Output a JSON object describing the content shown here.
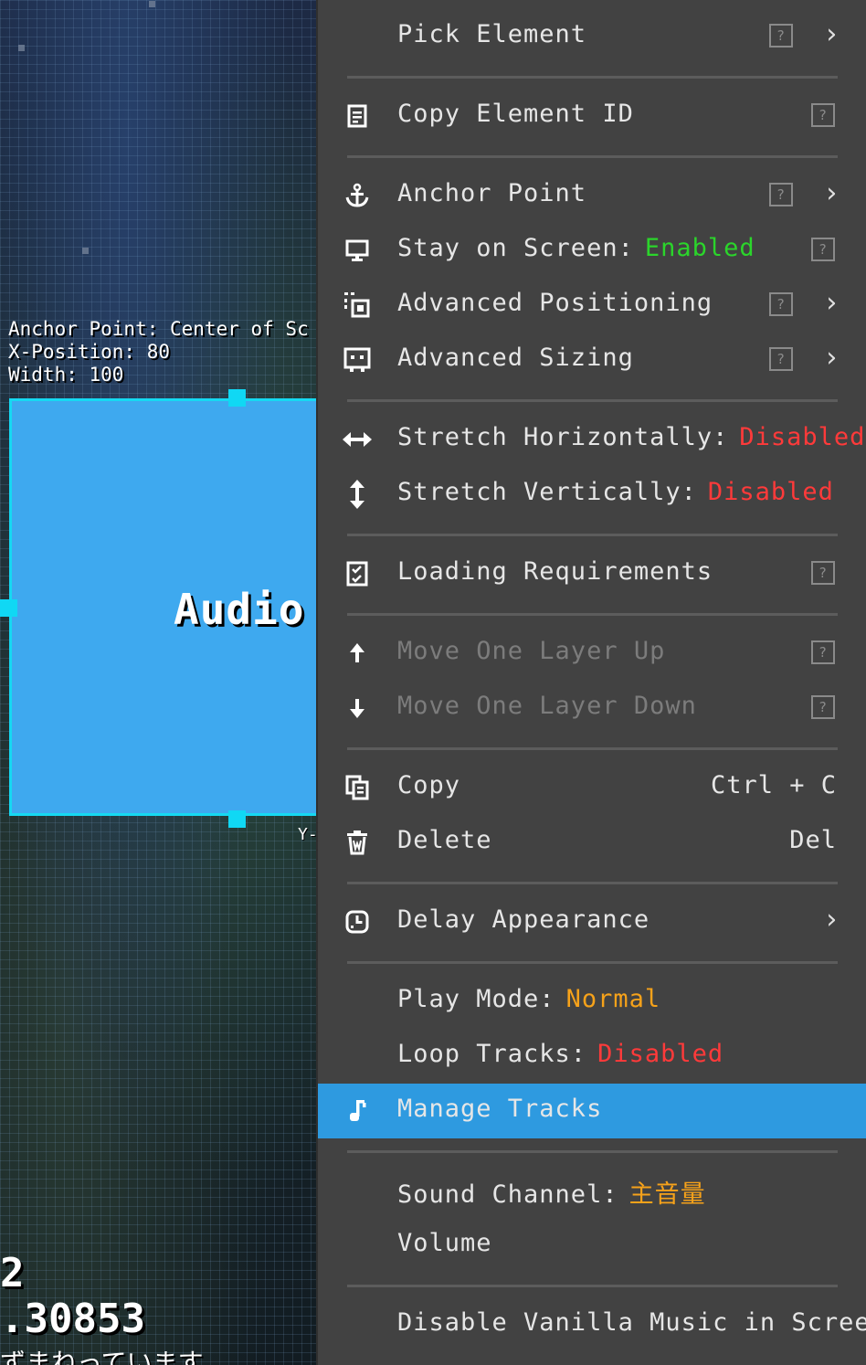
{
  "canvas": {
    "overlay_lines": [
      "Anchor Point: Center of Sc",
      "X-Position: 80",
      "Width: 100"
    ],
    "element_label": "Audio",
    "y_label": "Y-",
    "bottom_lines": [
      "2",
      ".30853"
    ],
    "bottom_jp": "ずまねっています"
  },
  "colors": {
    "menu_bg": "#424242",
    "highlight": "#2e9ae0",
    "enabled": "#2bd52b",
    "disabled": "#ff3a3a",
    "accent": "#f6a21a",
    "element_fill": "#3ea9ef",
    "element_border": "#16d9f2"
  },
  "menu": {
    "help_glyph": "?",
    "chevron": "›",
    "items": [
      {
        "label": "Pick Element",
        "icon": ""
      },
      {
        "label": "Copy Element ID",
        "icon": "document-icon"
      },
      {
        "label": "Anchor Point",
        "icon": "anchor-icon"
      },
      {
        "label": "Stay on Screen:",
        "value": "Enabled",
        "icon": "monitor-icon"
      },
      {
        "label": "Advanced Positioning",
        "icon": "positioning-icon"
      },
      {
        "label": "Advanced Sizing",
        "icon": "sizing-icon"
      },
      {
        "label": "Stretch Horizontally:",
        "value": "Disabled",
        "icon": "horizontal-arrows-icon"
      },
      {
        "label": "Stretch Vertically:",
        "value": "Disabled",
        "icon": "vertical-arrows-icon"
      },
      {
        "label": "Loading Requirements",
        "icon": "checklist-icon"
      },
      {
        "label": "Move One Layer Up",
        "icon": "arrow-up-icon"
      },
      {
        "label": "Move One Layer Down",
        "icon": "arrow-down-icon"
      },
      {
        "label": "Copy",
        "shortcut": "Ctrl + C",
        "icon": "copy-icon"
      },
      {
        "label": "Delete",
        "shortcut": "Del",
        "icon": "trash-icon"
      },
      {
        "label": "Delay Appearance",
        "icon": "clock-icon"
      },
      {
        "label": "Play Mode:",
        "value": "Normal",
        "icon": ""
      },
      {
        "label": "Loop Tracks:",
        "value": "Disabled",
        "icon": ""
      },
      {
        "label": "Manage Tracks",
        "icon": "music-note-icon"
      },
      {
        "label": "Sound Channel:",
        "value": "主音量",
        "icon": ""
      },
      {
        "label": "Volume",
        "icon": ""
      },
      {
        "label": "Disable Vanilla Music in Screens",
        "icon": ""
      }
    ]
  }
}
